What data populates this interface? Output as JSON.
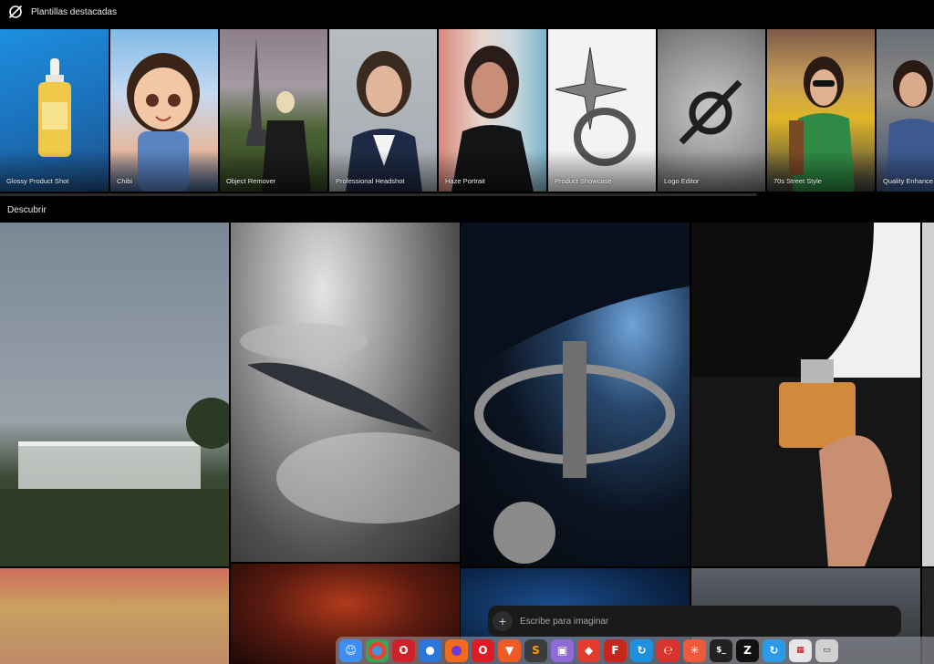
{
  "header": {
    "title": "Plantillas destacadas",
    "logo_icon": "slashed-circle-logo-icon"
  },
  "templates": [
    {
      "label": "Glossy Product Shot"
    },
    {
      "label": "Chibi"
    },
    {
      "label": "Object Remover"
    },
    {
      "label": "Professional Headshot"
    },
    {
      "label": "Haze Portrait"
    },
    {
      "label": "Product Showcase"
    },
    {
      "label": "Logo Editor"
    },
    {
      "label": "70s Street Style"
    },
    {
      "label": "Quality Enhance"
    }
  ],
  "discover": {
    "title": "Descubrir"
  },
  "prompt": {
    "placeholder": "Escribe para imaginar",
    "add_icon": "plus-icon"
  },
  "dock": {
    "apps": [
      {
        "name": "finder-icon",
        "color": "#3d8ef0"
      },
      {
        "name": "chrome-icon",
        "color": "#e4452f"
      },
      {
        "name": "opera-gx-icon",
        "color": "#d1202a"
      },
      {
        "name": "chromium-icon",
        "color": "#2b76d9"
      },
      {
        "name": "firefox-icon",
        "color": "#f26b1d"
      },
      {
        "name": "opera-icon",
        "color": "#e01b24"
      },
      {
        "name": "brave-icon",
        "color": "#f05a24"
      },
      {
        "name": "sublime-text-icon",
        "color": "#3b3b3b"
      },
      {
        "name": "preview-icon",
        "color": "#8e6bd6"
      },
      {
        "name": "anydesk-icon",
        "color": "#e33b2e"
      },
      {
        "name": "filezilla-icon",
        "color": "#c7261e"
      },
      {
        "name": "sync-icon",
        "color": "#1e90e0"
      },
      {
        "name": "scribble-app-icon",
        "color": "#d8332c"
      },
      {
        "name": "burst-app-icon",
        "color": "#ef5a3a"
      },
      {
        "name": "terminal-icon",
        "color": "#222222"
      },
      {
        "name": "z-app-icon",
        "color": "#111111"
      },
      {
        "name": "sync-alt-icon",
        "color": "#2d9ae8"
      },
      {
        "name": "activity-monitor-icon",
        "color": "#e6e6e6"
      },
      {
        "name": "device-icon",
        "color": "#d0d0d0"
      }
    ]
  }
}
